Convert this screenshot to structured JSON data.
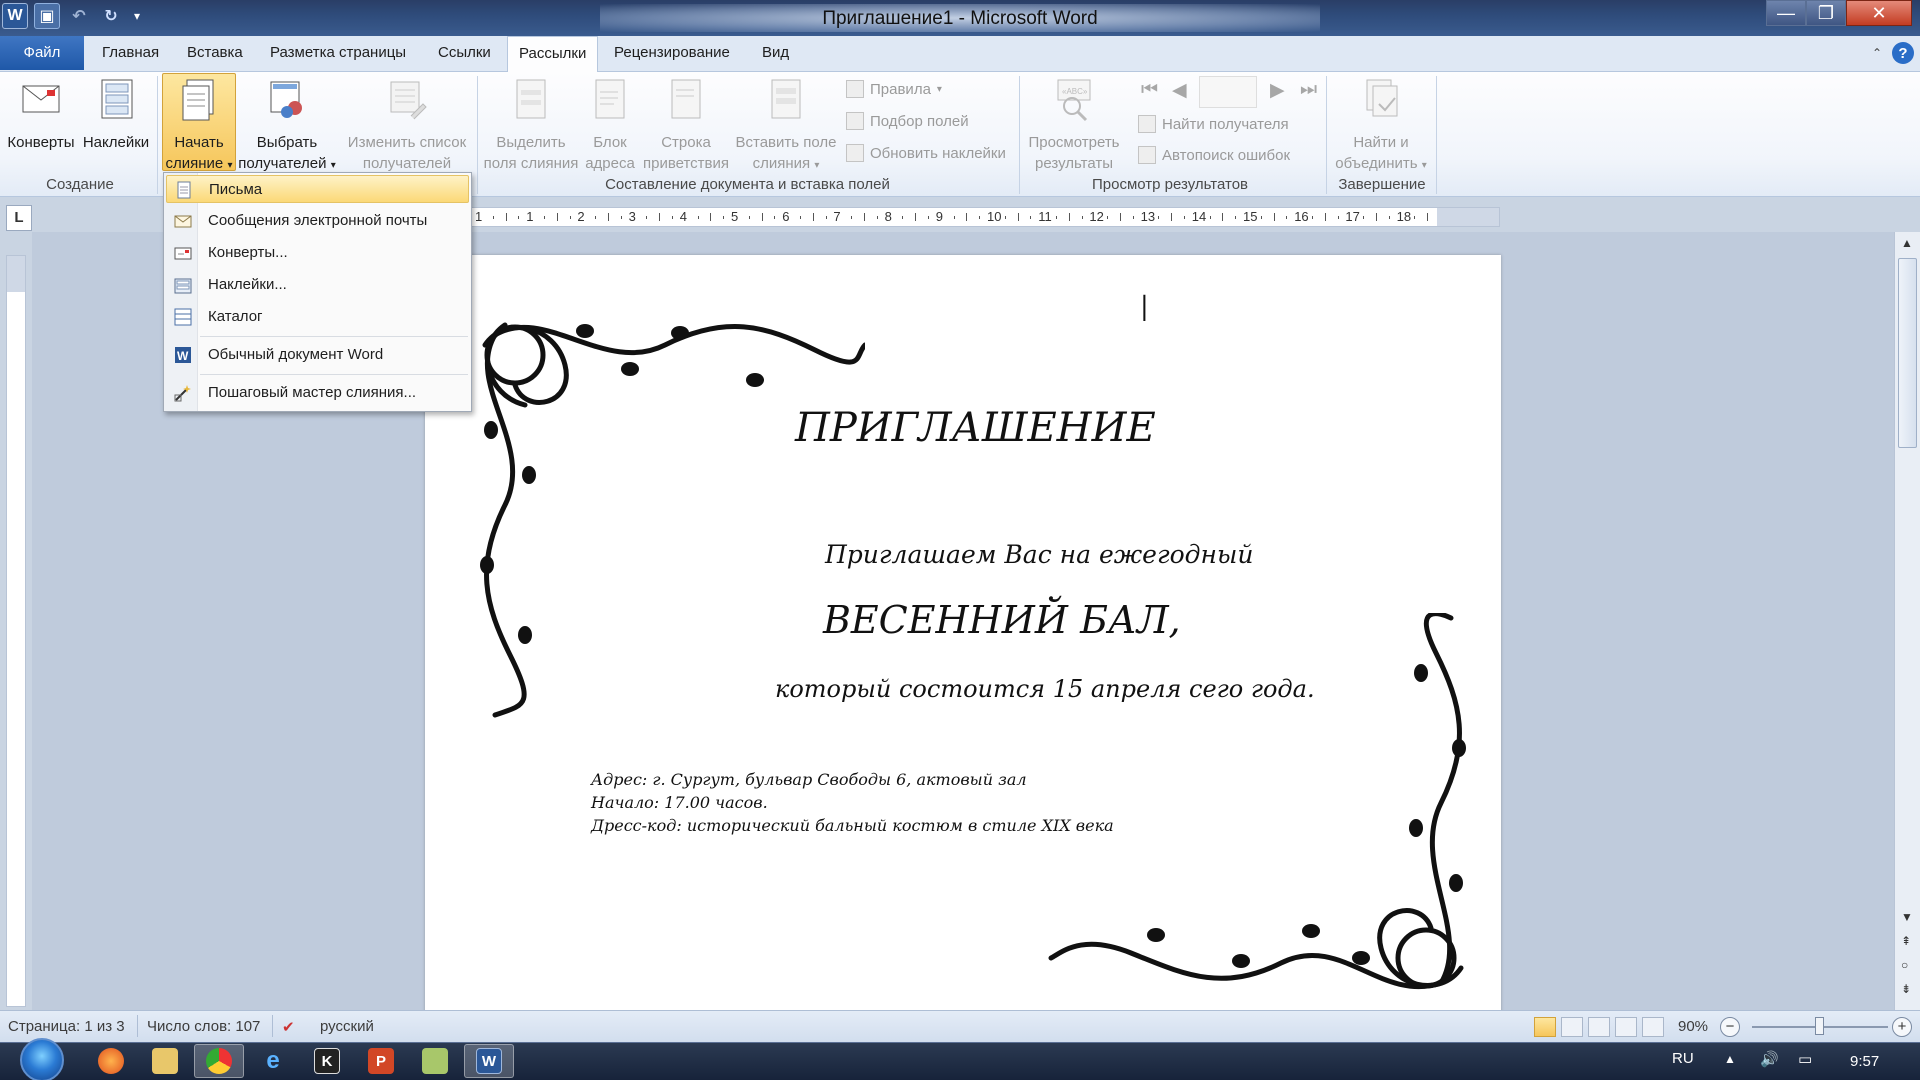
{
  "window": {
    "title": "Приглашение1 - Microsoft Word",
    "minimize": "—",
    "restore": "❐",
    "close": "✕"
  },
  "tabs": {
    "file": "Файл",
    "items": [
      "Главная",
      "Вставка",
      "Разметка страницы",
      "Ссылки",
      "Рассылки",
      "Рецензирование",
      "Вид"
    ],
    "active": "Рассылки"
  },
  "ribbon": {
    "create_group": {
      "label": "Создание",
      "envelopes": "Конверты",
      "labels": "Наклейки"
    },
    "start_merge_group": {
      "start_merge_line1": "Начать",
      "start_merge_line2": "слияние",
      "select_recipients_line1": "Выбрать",
      "select_recipients_line2": "получателей",
      "edit_list_line1": "Изменить список",
      "edit_list_line2": "получателей"
    },
    "write_insert_group": {
      "label": "Составление документа и вставка полей",
      "highlight_line1": "Выделить",
      "highlight_line2": "поля слияния",
      "address_block_line1": "Блок",
      "address_block_line2": "адреса",
      "greeting_line1": "Строка",
      "greeting_line2": "приветствия",
      "insert_field_line1": "Вставить поле",
      "insert_field_line2": "слияния",
      "rules": "Правила",
      "match_fields": "Подбор полей",
      "update_labels": "Обновить наклейки"
    },
    "preview_group": {
      "label": "Просмотр результатов",
      "preview_line1": "Просмотреть",
      "preview_line2": "результаты",
      "find_recipient": "Найти получателя",
      "auto_check": "Автопоиск ошибок"
    },
    "finish_group": {
      "label": "Завершение",
      "finish_line1": "Найти и",
      "finish_line2": "объединить"
    }
  },
  "dropdown": {
    "items": [
      {
        "label": "Письма",
        "icon": "letter-icon"
      },
      {
        "label": "Сообщения электронной почты",
        "icon": "email-icon"
      },
      {
        "label": "Конверты...",
        "icon": "envelope-icon"
      },
      {
        "label": "Наклейки...",
        "icon": "labels-icon"
      },
      {
        "label": "Каталог",
        "icon": "directory-icon"
      },
      {
        "label": "Обычный документ Word",
        "icon": "word-doc-icon"
      },
      {
        "label": "Пошаговый мастер слияния...",
        "icon": "wizard-icon"
      }
    ]
  },
  "ruler": {
    "corner": "L",
    "numbers": [
      "1",
      "1",
      "2",
      "3",
      "4",
      "5",
      "6",
      "7",
      "8",
      "9",
      "10",
      "11",
      "12",
      "13",
      "14",
      "15",
      "16",
      "17",
      "18"
    ]
  },
  "document": {
    "cursor": "|",
    "title": "ПРИГЛАШЕНИЕ",
    "line1": "Приглашаем Вас на ежегодный",
    "line2": "ВЕСЕННИЙ БАЛ,",
    "line3": "который состоится 15 апреля сего года.",
    "address": "Адрес: г. Сургут, бульвар Свободы 6, актовый зал",
    "start": "Начало: 17.00 часов.",
    "dresscode": "Дресс-код: исторический бальный костюм в стиле XIX века"
  },
  "statusbar": {
    "page": "Страница: 1 из 3",
    "words": "Число слов: 107",
    "language": "русский",
    "zoom": "90%",
    "zoom_level": 0.5
  },
  "taskbar": {
    "language": "RU",
    "time": "9:57"
  },
  "colors": {
    "accent": "#2b5797",
    "file_tab": "#1f58a8",
    "highlight": "#fbd977"
  }
}
